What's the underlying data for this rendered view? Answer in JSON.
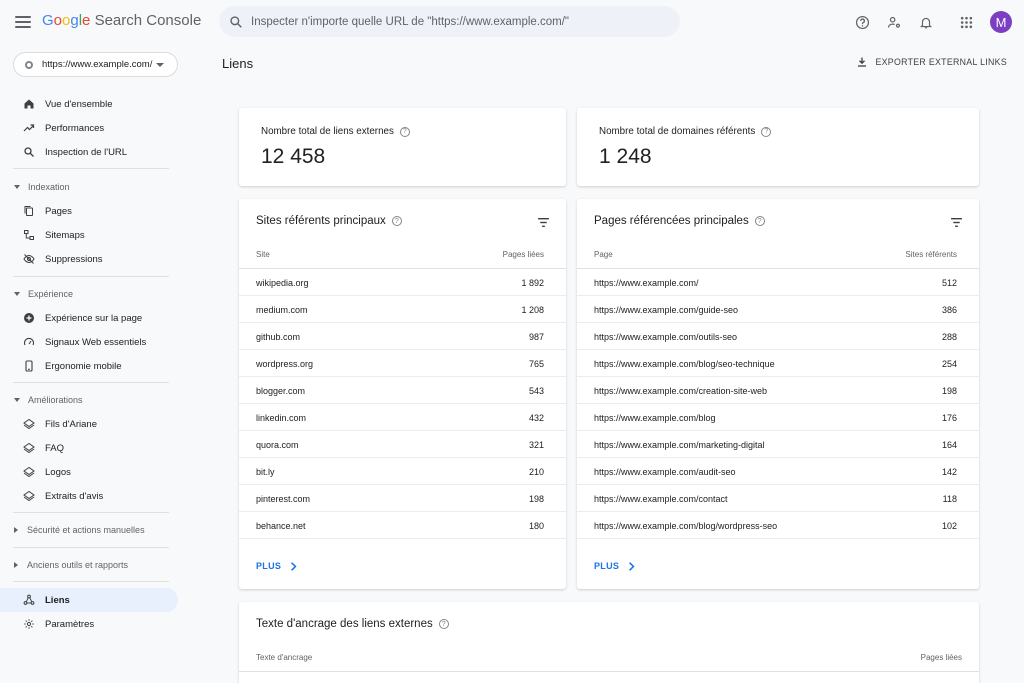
{
  "header": {
    "brand": {
      "g": "G",
      "o1": "o",
      "o2": "o",
      "g2": "g",
      "l": "l",
      "e": "e",
      "product": "Search Console"
    },
    "search_placeholder": "Inspecter n'importe quelle URL de \"https://www.example.com/\"",
    "avatar_initial": "M",
    "icons": [
      "menu-icon",
      "search-icon",
      "help-icon",
      "people-settings-icon",
      "bell-icon",
      "apps-grid-icon"
    ]
  },
  "sidebar": {
    "property": "https://www.example.com/",
    "items": [
      {
        "label": "Vue d'ensemble",
        "icon": "home-icon"
      },
      {
        "label": "Performances",
        "icon": "trending-up-icon"
      },
      {
        "label": "Inspection de l'URL",
        "icon": "search-icon"
      }
    ],
    "indexation": {
      "title": "Indexation",
      "items": [
        "Pages",
        "Sitemaps",
        "Suppressions"
      ]
    },
    "experience": {
      "title": "Expérience",
      "items": [
        "Expérience sur la page",
        "Signaux Web essentiels",
        "Ergonomie mobile"
      ]
    },
    "ameliorations": {
      "title": "Améliorations",
      "items": [
        "Fils d'Ariane",
        "FAQ",
        "Logos",
        "Extraits d'avis"
      ]
    },
    "securite": "Sécurité et actions manuelles",
    "anciens": "Anciens outils et rapports",
    "liens": "Liens",
    "parametres": "Paramètres"
  },
  "main": {
    "title": "Liens",
    "export_label": "EXPORTER EXTERNAL LINKS",
    "kpi1": {
      "label": "Nombre total de liens externes",
      "value": "12 458"
    },
    "kpi2": {
      "label": "Nombre total de domaines référents",
      "value": "1 248"
    },
    "sites": {
      "title": "Sites référents principaux",
      "col1": "Site",
      "col2": "Pages liées",
      "rows": [
        {
          "site": "wikipedia.org",
          "value": "1 892"
        },
        {
          "site": "medium.com",
          "value": "1 208"
        },
        {
          "site": "github.com",
          "value": "987"
        },
        {
          "site": "wordpress.org",
          "value": "765"
        },
        {
          "site": "blogger.com",
          "value": "543"
        },
        {
          "site": "linkedin.com",
          "value": "432"
        },
        {
          "site": "quora.com",
          "value": "321"
        },
        {
          "site": "bit.ly",
          "value": "210"
        },
        {
          "site": "pinterest.com",
          "value": "198"
        },
        {
          "site": "behance.net",
          "value": "180"
        }
      ],
      "more": "PLUS"
    },
    "pages": {
      "title": "Pages référencées principales",
      "col1": "Page",
      "col2": "Sites référents",
      "rows": [
        {
          "page": "https://www.example.com/",
          "value": "512"
        },
        {
          "page": "https://www.example.com/guide-seo",
          "value": "386"
        },
        {
          "page": "https://www.example.com/outils-seo",
          "value": "288"
        },
        {
          "page": "https://www.example.com/blog/seo-technique",
          "value": "254"
        },
        {
          "page": "https://www.example.com/creation-site-web",
          "value": "198"
        },
        {
          "page": "https://www.example.com/blog",
          "value": "176"
        },
        {
          "page": "https://www.example.com/marketing-digital",
          "value": "164"
        },
        {
          "page": "https://www.example.com/audit-seo",
          "value": "142"
        },
        {
          "page": "https://www.example.com/contact",
          "value": "118"
        },
        {
          "page": "https://www.example.com/blog/wordpress-seo",
          "value": "102"
        }
      ],
      "more": "PLUS"
    },
    "anchor": {
      "title": "Texte d'ancrage des liens externes",
      "col1": "Texte d'ancrage",
      "col2": "Pages liées"
    }
  },
  "colors": {
    "accent": "#1a73e8",
    "active_bg": "#e8f0fe",
    "avatar": "#7b3fc4"
  }
}
